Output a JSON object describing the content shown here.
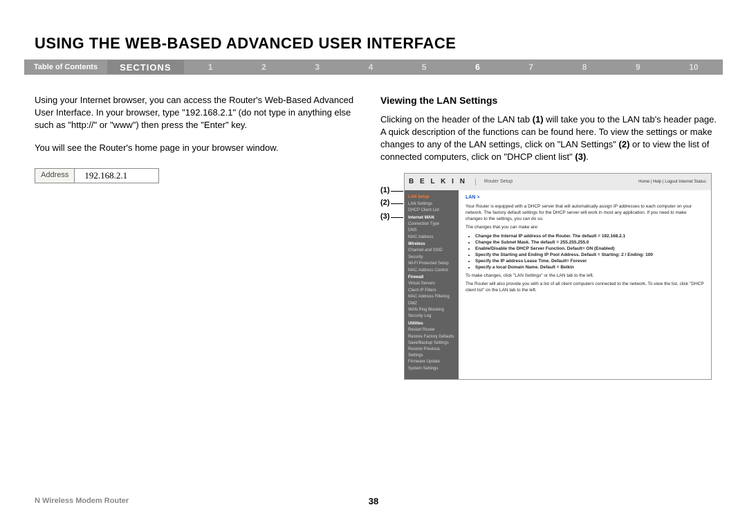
{
  "title": "USING THE WEB-BASED ADVANCED USER INTERFACE",
  "nav": {
    "toc": "Table of Contents",
    "sectionsLabel": "SECTIONS",
    "numbers": [
      "1",
      "2",
      "3",
      "4",
      "5",
      "6",
      "7",
      "8",
      "9",
      "10"
    ],
    "active": "6"
  },
  "left": {
    "para1": "Using your Internet browser, you can access the Router's Web-Based Advanced User Interface. In your browser, type \"192.168.2.1\" (do not type in anything else such as \"http://\" or \"www\") then press the \"Enter\" key.",
    "para2": "You will see the Router's home page in your browser window.",
    "address": {
      "label": "Address",
      "value": "192.168.2.1"
    }
  },
  "right": {
    "heading": "Viewing the LAN Settings",
    "para_a": "Clicking on the header of the LAN tab ",
    "b1": "(1)",
    "para_b": " will take you to the LAN tab's header page. A quick description of the functions can be found here. To view the settings or make changes to any of the LAN settings, click on \"LAN Settings\" ",
    "b2": "(2)",
    "para_c": " or to view the list of connected computers, click on \"DHCP client list\" ",
    "b3": "(3)",
    "para_d": "."
  },
  "callouts": {
    "c1": "(1)",
    "c2": "(2)",
    "c3": "(3)"
  },
  "router": {
    "logo": "B E L K I N",
    "title": "Router Setup",
    "links": "Home | Help | Logout   Internet Status:",
    "lanLink": "LAN >",
    "p1": "Your Router is equipped with a DHCP server that will automatically assign IP addresses to each computer on your network. The factory default settings for the DHCP server will work in most any application. If you need to make changes to the settings, you can do so.",
    "p2": "The changes that you can make are:",
    "li1": "Change the Internal IP address of the Router. The default = 192.168.2.1",
    "li2": "Change the Subnet Mask. The default = 255.255.255.0",
    "li3": "Enable/Disable the DHCP Server Function. Default= ON (Enabled)",
    "li4": "Specify the Starting and Ending IP Pool Address. Default = Starting: 2 / Ending: 100",
    "li5": "Specify the IP address Lease Time. Default= Forever",
    "li6": "Specify a local Domain Name. Default = Belkin",
    "p3": "To make changes, click \"LAN Settings\" or the LAN tab to the left.",
    "p4": "The Router will also provide you with a list of all client computers connected to the network. To view the list, click \"DHCP client list\" on the LAN tab to the left.",
    "side": {
      "lanSetup": "LAN Setup",
      "lanSettings": "LAN Settings",
      "dhcpList": "DHCP Client List",
      "internetWan": "Internet WAN",
      "connType": "Connection Type",
      "dns": "DNS",
      "macAddr": "MAC Address",
      "wireless": "Wireless",
      "chanSsid": "Channel and SSID",
      "security": "Security",
      "wps": "Wi-Fi Protected Setup",
      "macControl": "MAC Address Control",
      "firewall": "Firewall",
      "vservers": "Virtual Servers",
      "cfilters": "Client IP Filters",
      "macFilter": "MAC Address Filtering",
      "dmz": "DMZ",
      "wanPing": "WAN Ping Blocking",
      "secLog": "Security Log",
      "utilities": "Utilities",
      "restart": "Restart Router",
      "factory": "Restore Factory Defaults",
      "saveBackup": "Save/Backup Settings",
      "restorePrev": "Restore Previous Settings",
      "fwUpdate": "Firmware Update",
      "sysSettings": "System Settings"
    }
  },
  "footer": {
    "product": "N Wireless Modem Router",
    "page": "38"
  }
}
